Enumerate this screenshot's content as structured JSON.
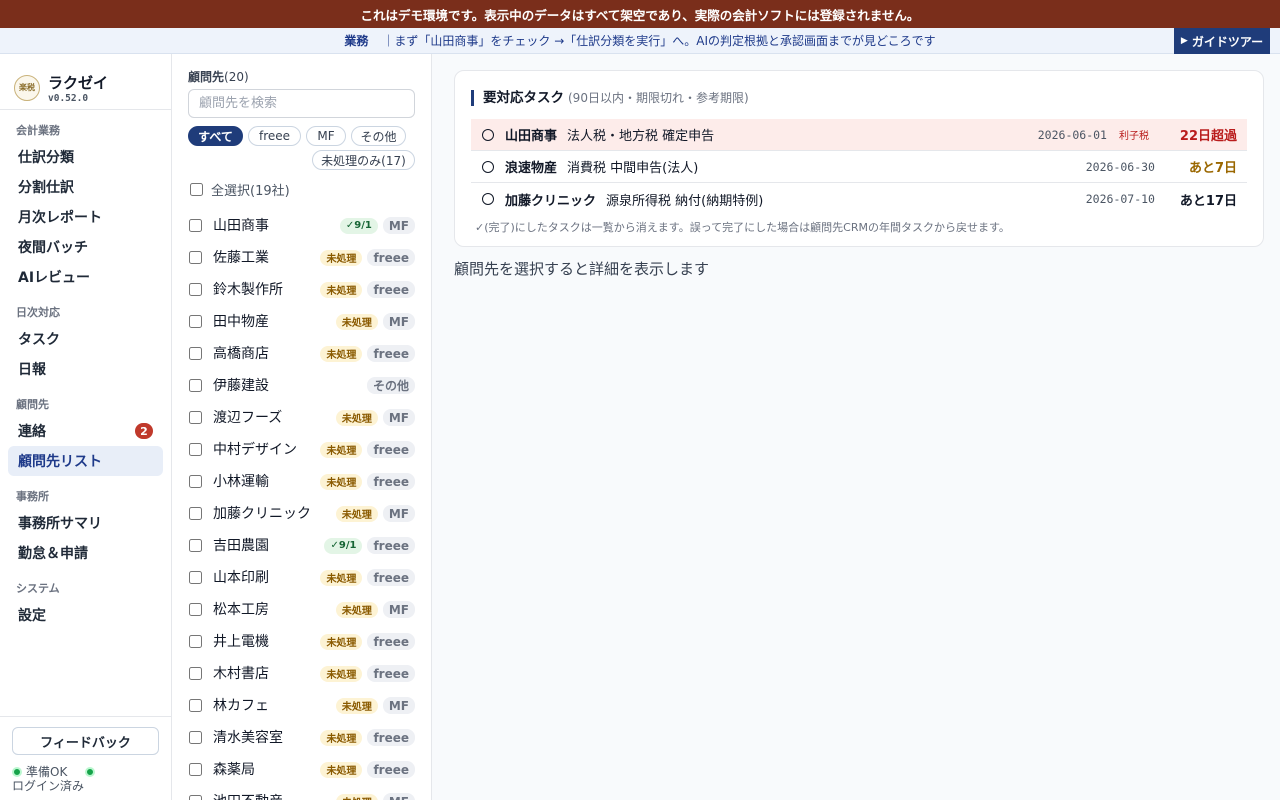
{
  "banner": {
    "text": "これはデモ環境です。表示中のデータはすべて架空であり、実際の会計ソフトには登録されません。"
  },
  "guide": {
    "tag": "業務",
    "text": "｜まず「山田商事」をチェック →「仕訳分類を実行」へ。AIの判定根拠と承認画面までが見どころです",
    "button": "ガイドツアー"
  },
  "brand": {
    "logo_text": "楽税",
    "name": "ラクゼイ",
    "version": "v0.52.0"
  },
  "nav": {
    "sections": [
      {
        "label": "会計業務",
        "items": [
          "仕訳分類",
          "分割仕訳",
          "月次レポート",
          "夜間バッチ",
          "AIレビュー"
        ]
      },
      {
        "label": "日次対応",
        "items": [
          "タスク",
          "日報"
        ]
      },
      {
        "label": "顧問先",
        "items": [
          "連絡",
          "顧問先リスト"
        ]
      },
      {
        "label": "事務所",
        "items": [
          "事務所サマリ",
          "勤怠＆申請"
        ]
      },
      {
        "label": "システム",
        "items": [
          "設定"
        ]
      }
    ],
    "badge_contact": "2",
    "active": "顧問先リスト"
  },
  "footer": {
    "feedback": "フィードバック",
    "status": "準備OK",
    "login": "ログイン済み"
  },
  "clients": {
    "title": "顧問先",
    "count": "(20)",
    "search_placeholder": "顧問先を検索",
    "filters": [
      "すべて",
      "freee",
      "MF",
      "その他",
      "未処理のみ(17)"
    ],
    "select_all": "全選択(19社)",
    "rows": [
      {
        "name": "山田商事",
        "status": "✓9/1",
        "status_type": "done",
        "soft": "MF"
      },
      {
        "name": "佐藤工業",
        "status": "未処理",
        "status_type": "pending",
        "soft": "freee"
      },
      {
        "name": "鈴木製作所",
        "status": "未処理",
        "status_type": "pending",
        "soft": "freee"
      },
      {
        "name": "田中物産",
        "status": "未処理",
        "status_type": "pending",
        "soft": "MF"
      },
      {
        "name": "高橋商店",
        "status": "未処理",
        "status_type": "pending",
        "soft": "freee"
      },
      {
        "name": "伊藤建設",
        "status": "",
        "status_type": "none",
        "soft": "その他"
      },
      {
        "name": "渡辺フーズ",
        "status": "未処理",
        "status_type": "pending",
        "soft": "MF"
      },
      {
        "name": "中村デザイン",
        "status": "未処理",
        "status_type": "pending",
        "soft": "freee"
      },
      {
        "name": "小林運輸",
        "status": "未処理",
        "status_type": "pending",
        "soft": "freee"
      },
      {
        "name": "加藤クリニック",
        "status": "未処理",
        "status_type": "pending",
        "soft": "MF"
      },
      {
        "name": "吉田農園",
        "status": "✓9/1",
        "status_type": "done",
        "soft": "freee"
      },
      {
        "name": "山本印刷",
        "status": "未処理",
        "status_type": "pending",
        "soft": "freee"
      },
      {
        "name": "松本工房",
        "status": "未処理",
        "status_type": "pending",
        "soft": "MF"
      },
      {
        "name": "井上電機",
        "status": "未処理",
        "status_type": "pending",
        "soft": "freee"
      },
      {
        "name": "木村書店",
        "status": "未処理",
        "status_type": "pending",
        "soft": "freee"
      },
      {
        "name": "林カフェ",
        "status": "未処理",
        "status_type": "pending",
        "soft": "MF"
      },
      {
        "name": "清水美容室",
        "status": "未処理",
        "status_type": "pending",
        "soft": "freee"
      },
      {
        "name": "森薬局",
        "status": "未処理",
        "status_type": "pending",
        "soft": "freee"
      },
      {
        "name": "池田不動産",
        "status": "未処理",
        "status_type": "pending",
        "soft": "MF"
      }
    ]
  },
  "tasks": {
    "title": "要対応タスク",
    "subtitle": "(90日以内・期限切れ・参考期限)",
    "rows": [
      {
        "client": "山田商事",
        "task": "法人税・地方税 確定申告",
        "date": "2026-06-01",
        "note": "利子税",
        "remain": "22日超過",
        "level": "red"
      },
      {
        "client": "浪速物産",
        "task": "消費税 中間申告(法人)",
        "date": "2026-06-30",
        "note": "",
        "remain": "あと7日",
        "level": "amber"
      },
      {
        "client": "加藤クリニック",
        "task": "源泉所得税 納付(納期特例)",
        "date": "2026-07-10",
        "note": "",
        "remain": "あと17日",
        "level": "dark"
      }
    ],
    "footnote": "✓(完了)にしたタスクは一覧から消えます。誤って完了にした場合は顧問先CRMの年間タスクから戻せます。"
  },
  "main": {
    "placeholder": "顧問先を選択すると詳細を表示します"
  }
}
